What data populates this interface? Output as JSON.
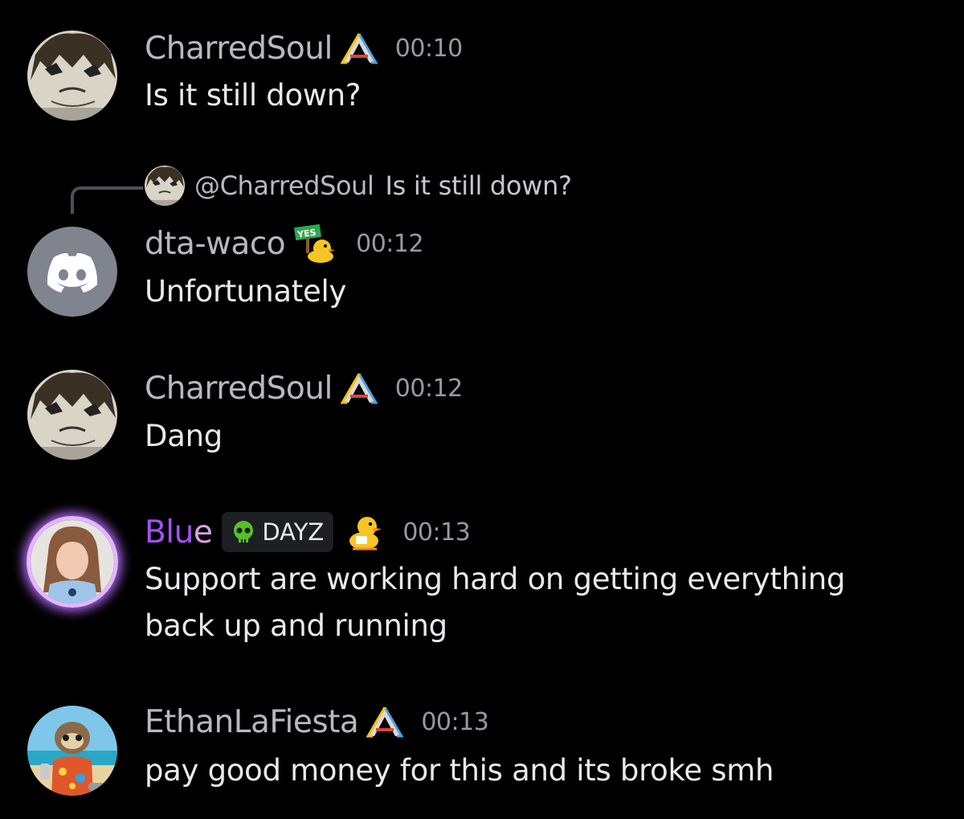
{
  "messages": [
    {
      "username": "CharredSoul",
      "badge": "ark-icon",
      "timestamp": "00:10",
      "text": "Is it still down?"
    },
    {
      "reply_to": {
        "mention": "@CharredSoul",
        "text": "Is it still down?"
      },
      "username": "dta-waco",
      "badge": "yes-duck-icon",
      "badge_sign_text": "YES",
      "timestamp": "00:12",
      "text": "Unfortunately"
    },
    {
      "username": "CharredSoul",
      "badge": "ark-icon",
      "timestamp": "00:12",
      "text": "Dang"
    },
    {
      "username_main": "Blu",
      "username_tail": "e",
      "guild_tag": "DAYZ",
      "badge": "duck-icon",
      "timestamp": "00:13",
      "text_line1": "Support are working hard on getting everything",
      "text_line2": "back up and running"
    },
    {
      "username": "EthanLaFiesta",
      "badge": "ark-icon",
      "timestamp": "00:13",
      "text": "pay good money for this and its broke smh"
    }
  ],
  "colors": {
    "background": "#000000",
    "username": "#b5bac1",
    "blue_username": "#a352f7",
    "timestamp": "#949ba4",
    "discord_avatar": "#80848e"
  }
}
